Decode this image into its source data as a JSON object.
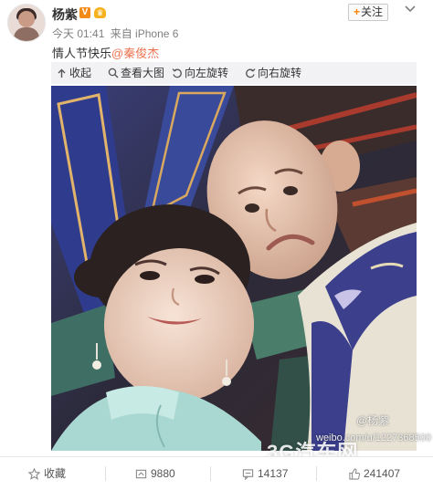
{
  "post": {
    "username": "杨紫",
    "verified_badge": "V",
    "vip_badge": "VIP",
    "time": "今天 01:41",
    "via": "来自 iPhone 6",
    "text_main": "情人节快乐",
    "mention": "@秦俊杰",
    "follow_label": "关注",
    "follow_plus": "+"
  },
  "media_toolbar": {
    "collapse_label": "收起",
    "view_large_label": "查看大图",
    "rotate_left_label": "向左旋转",
    "rotate_right_label": "向右旋转"
  },
  "watermarks": {
    "weibo": "@杨紫",
    "url": "weibo.com/u/1227368500",
    "site": "3G汽车网"
  },
  "footer": {
    "favorite_label": "收藏",
    "repost_count": "9880",
    "comment_count": "14137",
    "like_count": "241407"
  },
  "colors": {
    "accent": "#ff8200",
    "mention": "#eb7350",
    "muted": "#808080"
  },
  "icons": [
    "chevron-down-icon",
    "collapse-up-icon",
    "zoom-icon",
    "rotate-left-icon",
    "rotate-right-icon",
    "star-icon",
    "repost-icon",
    "comment-icon",
    "like-icon"
  ]
}
